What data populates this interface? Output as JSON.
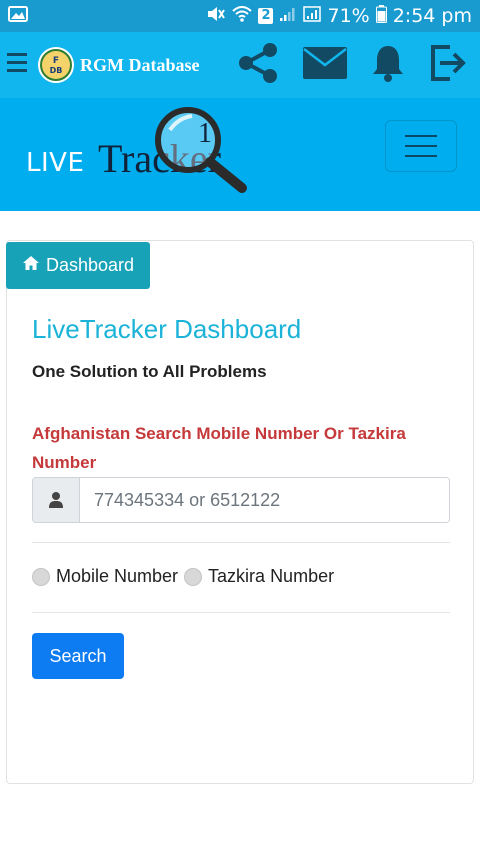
{
  "status_bar": {
    "battery": "71%",
    "time": "2:54 pm",
    "sim_label": "2",
    "icons": [
      "image-icon",
      "mute-icon",
      "wifi-icon",
      "signal-icon",
      "signal-icon",
      "battery-icon"
    ]
  },
  "app_bar": {
    "brand": "RGM Database",
    "logo_text": "F\nDB",
    "actions": [
      "share-icon",
      "mail-icon",
      "bell-icon",
      "logout-icon"
    ]
  },
  "banner": {
    "live": "LIVE",
    "tracker": "Tracker"
  },
  "card": {
    "tab_label": "Dashboard",
    "title": "LiveTracker Dashboard",
    "subtitle": "One Solution to All Problems",
    "search_prompt": "Afghanistan Search Mobile Number Or Tazkira Number",
    "input_placeholder": "774345334 or 6512122",
    "radio_options": [
      "Mobile Number",
      "Tazkira Number"
    ],
    "search_button": "Search"
  },
  "colors": {
    "status_bar": "#1a9bd0",
    "app_bar": "#12b6ef",
    "banner": "#00aeef",
    "tab": "#17a2b8",
    "title": "#1bb3d8",
    "alert": "#c5393b",
    "button": "#0d7cf2"
  }
}
